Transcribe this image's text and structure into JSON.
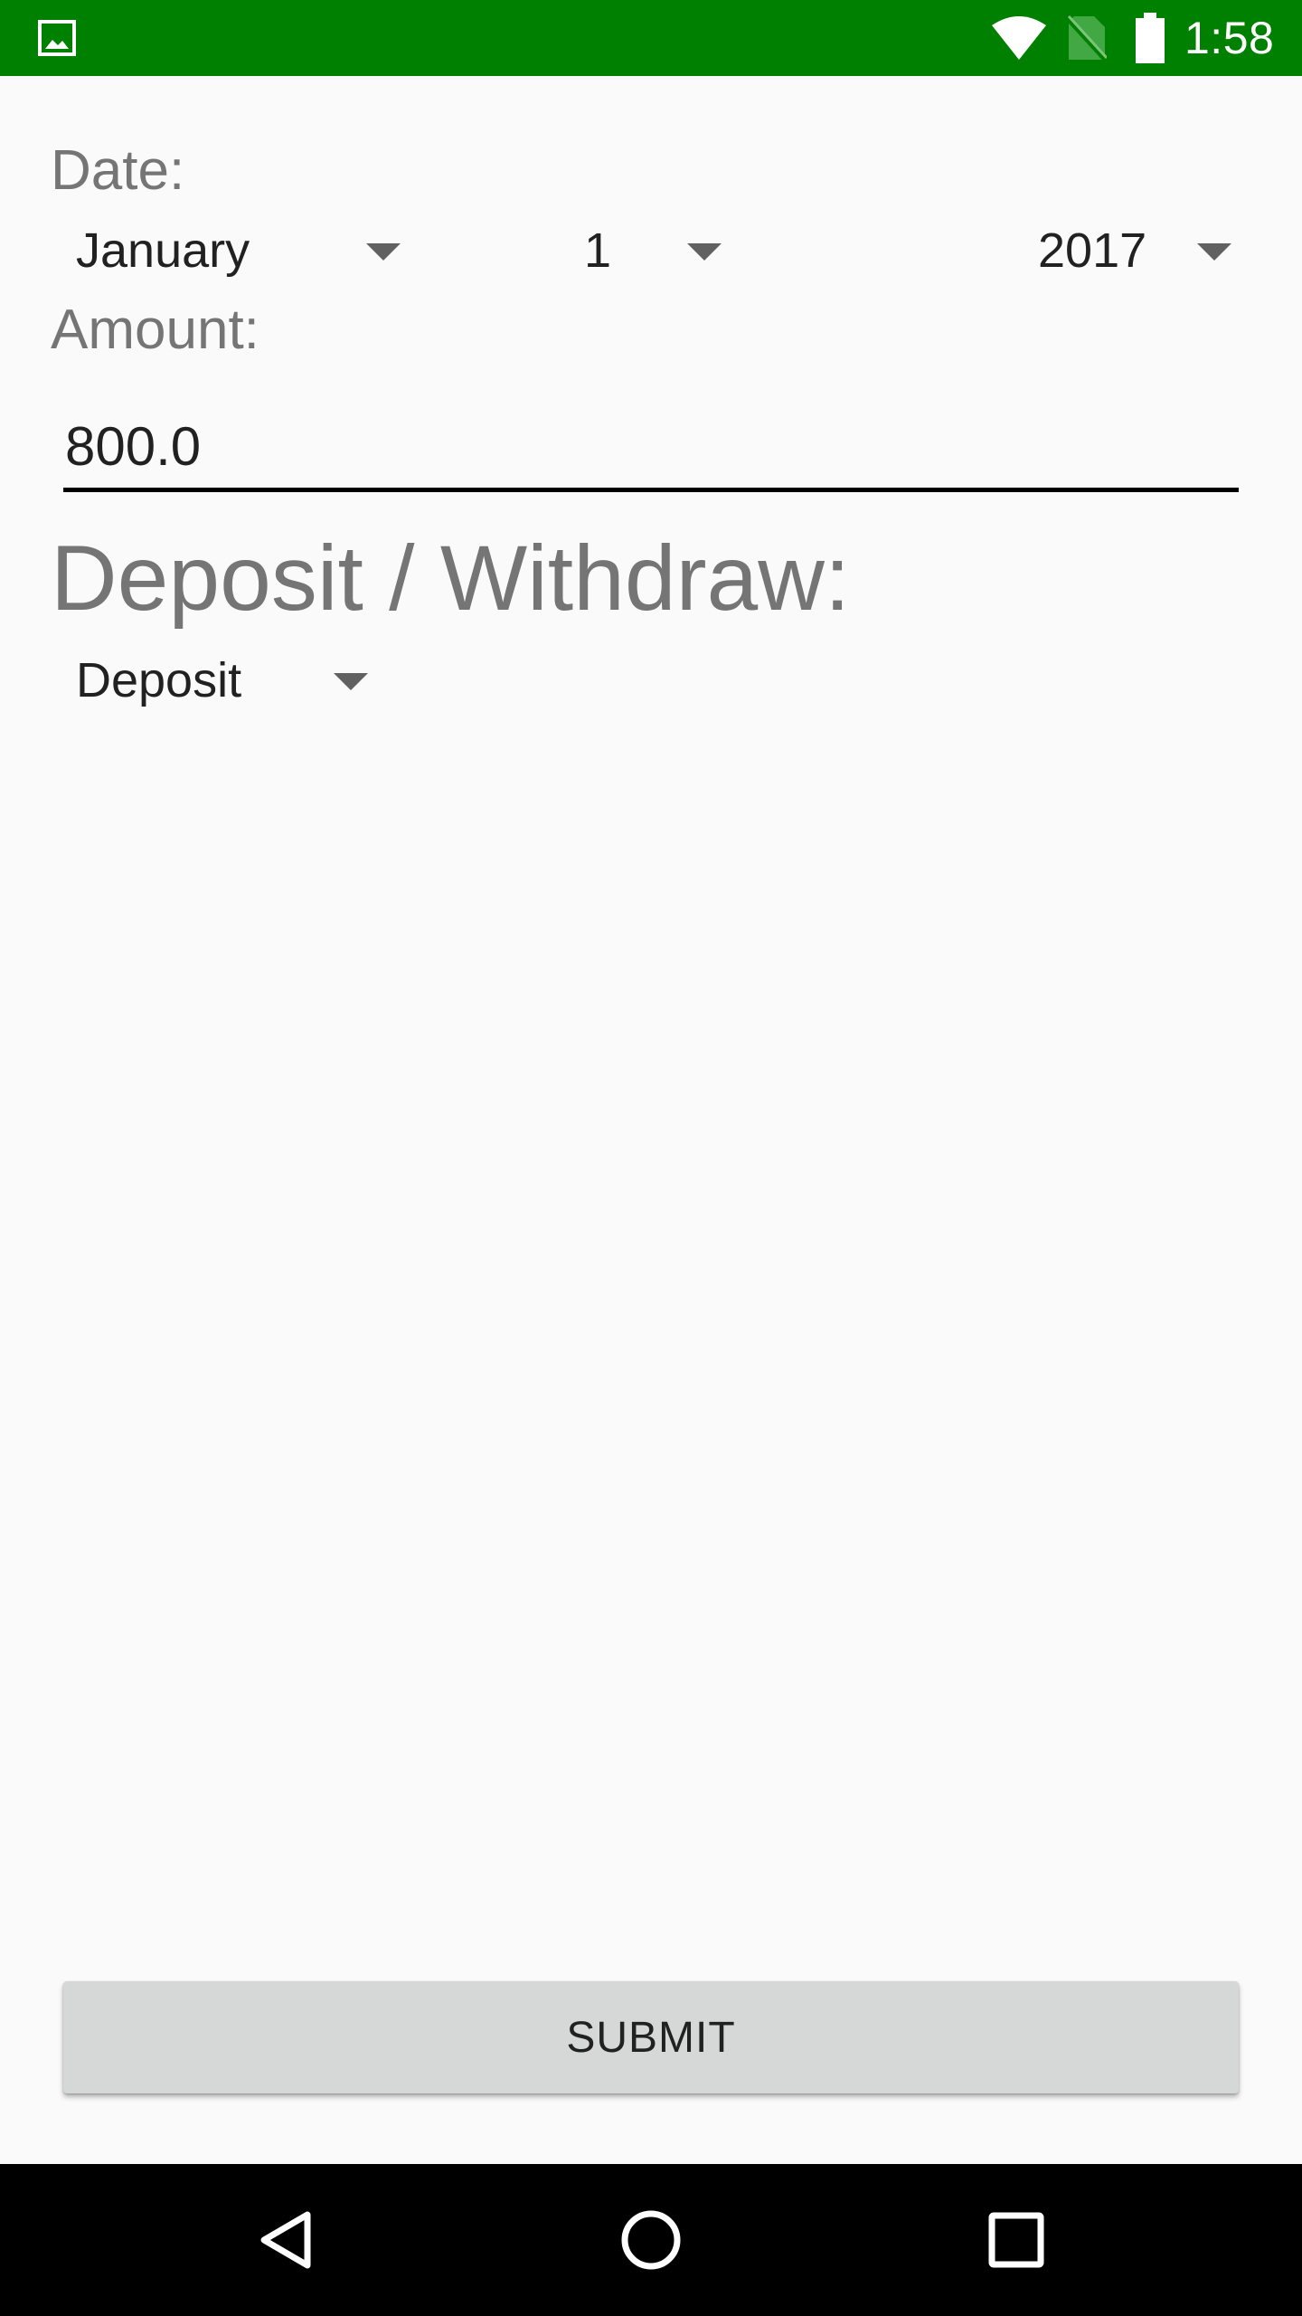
{
  "status_bar": {
    "time": "1:58",
    "icons": [
      "image-notification-icon",
      "wifi-icon",
      "no-sim-icon",
      "battery-icon"
    ]
  },
  "form": {
    "date_label": "Date:",
    "month": {
      "selected": "January"
    },
    "day": {
      "selected": "1"
    },
    "year": {
      "selected": "2017"
    },
    "amount_label": "Amount:",
    "amount_value": "800.0",
    "type_label": "Deposit / Withdraw:",
    "type": {
      "selected": "Deposit"
    },
    "submit_label": "SUBMIT"
  },
  "nav_bar": {
    "icons": [
      "back-icon",
      "home-icon",
      "recents-icon"
    ]
  },
  "colors": {
    "status_bar": "#008000",
    "background": "#FAFAFA",
    "label": "#757575",
    "button": "#D6D7D7",
    "nav_bar": "#000000"
  }
}
